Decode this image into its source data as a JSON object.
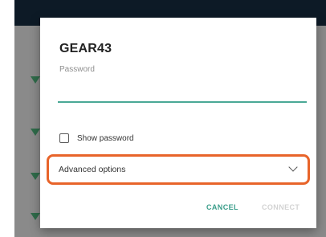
{
  "dialog": {
    "title": "GEAR43",
    "password_label": "Password",
    "password_value": "",
    "show_password_label": "Show password",
    "show_password_checked": false,
    "advanced_options_label": "Advanced options",
    "cancel_label": "CANCEL",
    "connect_label": "CONNECT",
    "connect_enabled": false
  },
  "colors": {
    "accent": "#3a9d8a",
    "highlight": "#e8642a",
    "backdrop": "#8a8a8a"
  },
  "icons": {
    "advanced_options": "chevron-down-icon",
    "wifi_list": "wifi-icon"
  }
}
